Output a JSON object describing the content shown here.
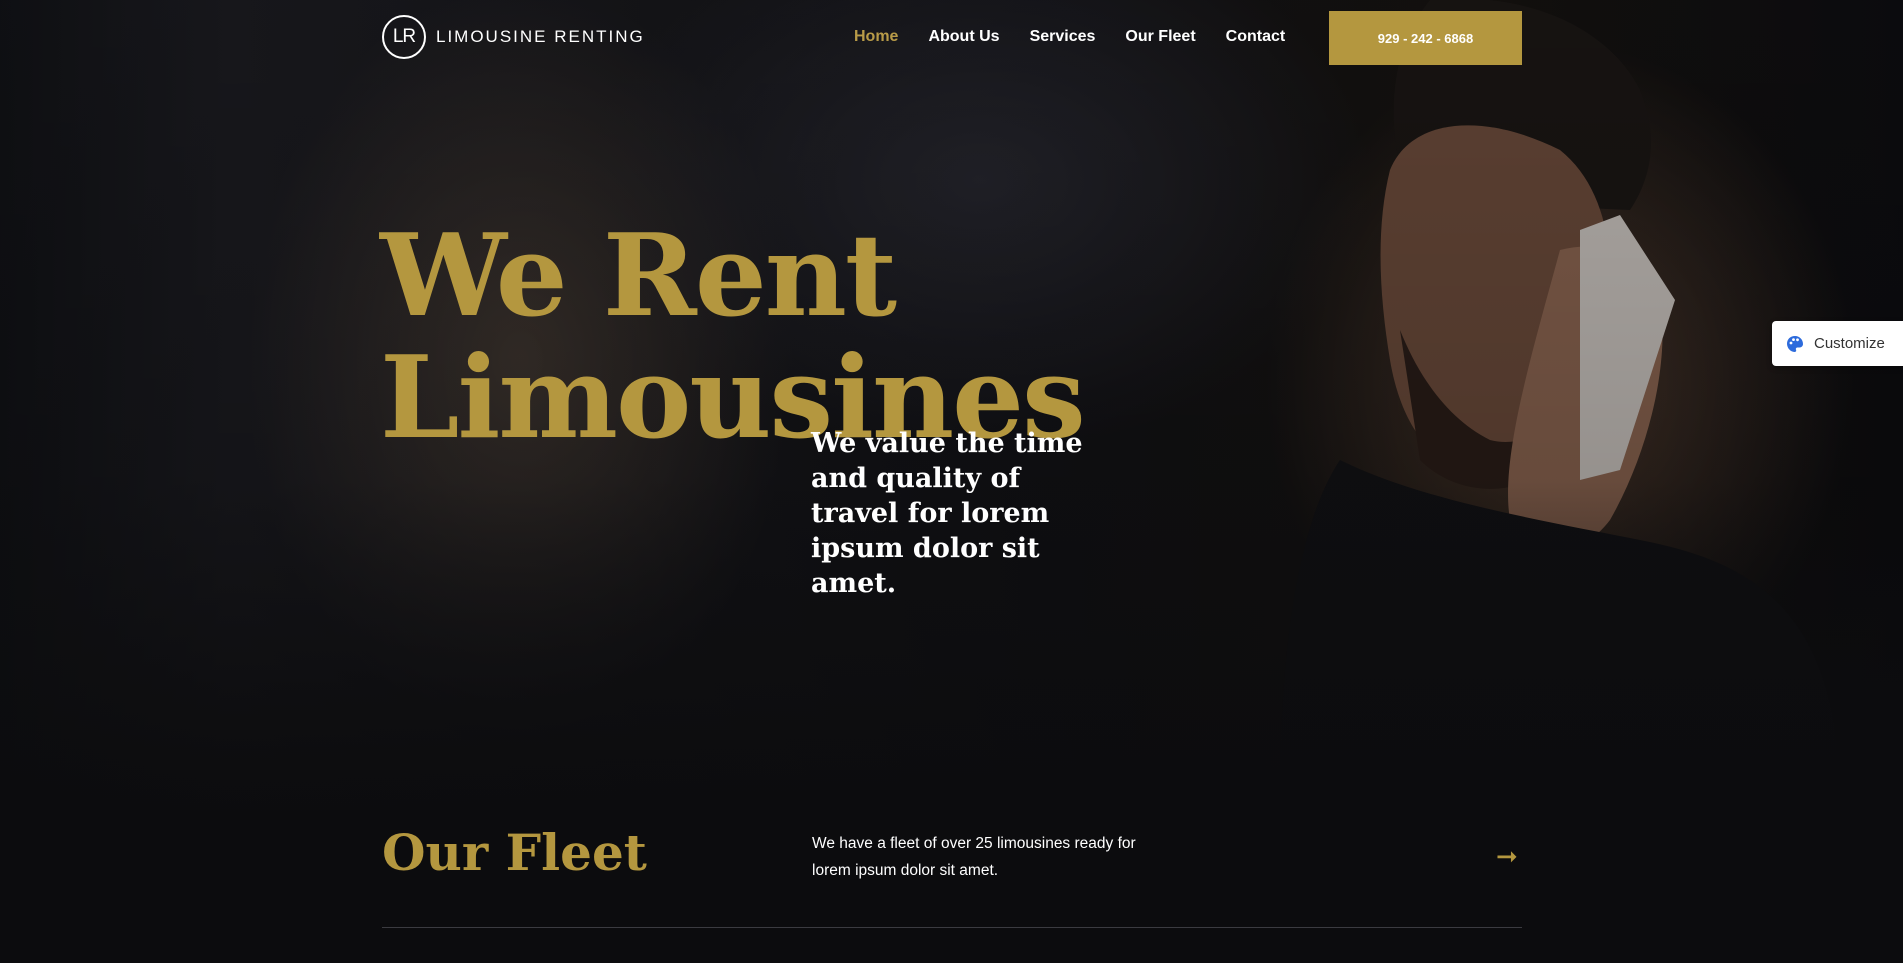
{
  "header": {
    "logo_mark": "LR",
    "logo_text": "LIMOUSINE RENTING",
    "nav": [
      {
        "label": "Home",
        "active": true
      },
      {
        "label": "About Us",
        "active": false
      },
      {
        "label": "Services",
        "active": false
      },
      {
        "label": "Our Fleet",
        "active": false
      },
      {
        "label": "Contact",
        "active": false
      }
    ],
    "phone_button": "929 - 242 - 6868"
  },
  "hero": {
    "title_line1": "We Rent",
    "title_line2": "Limousines",
    "subtitle": "We value the time and quality of travel for lorem ipsum dolor sit amet."
  },
  "customize": {
    "label": "Customize",
    "icon": "palette-icon"
  },
  "fleet": {
    "title": "Our Fleet",
    "description": "We have a fleet of over 25 limousines ready for lorem ipsum dolor sit amet.",
    "arrow_icon": "arrow-right-icon"
  },
  "colors": {
    "accent_gold": "#b4973f",
    "background": "#0c0c0e",
    "text": "#ffffff"
  }
}
